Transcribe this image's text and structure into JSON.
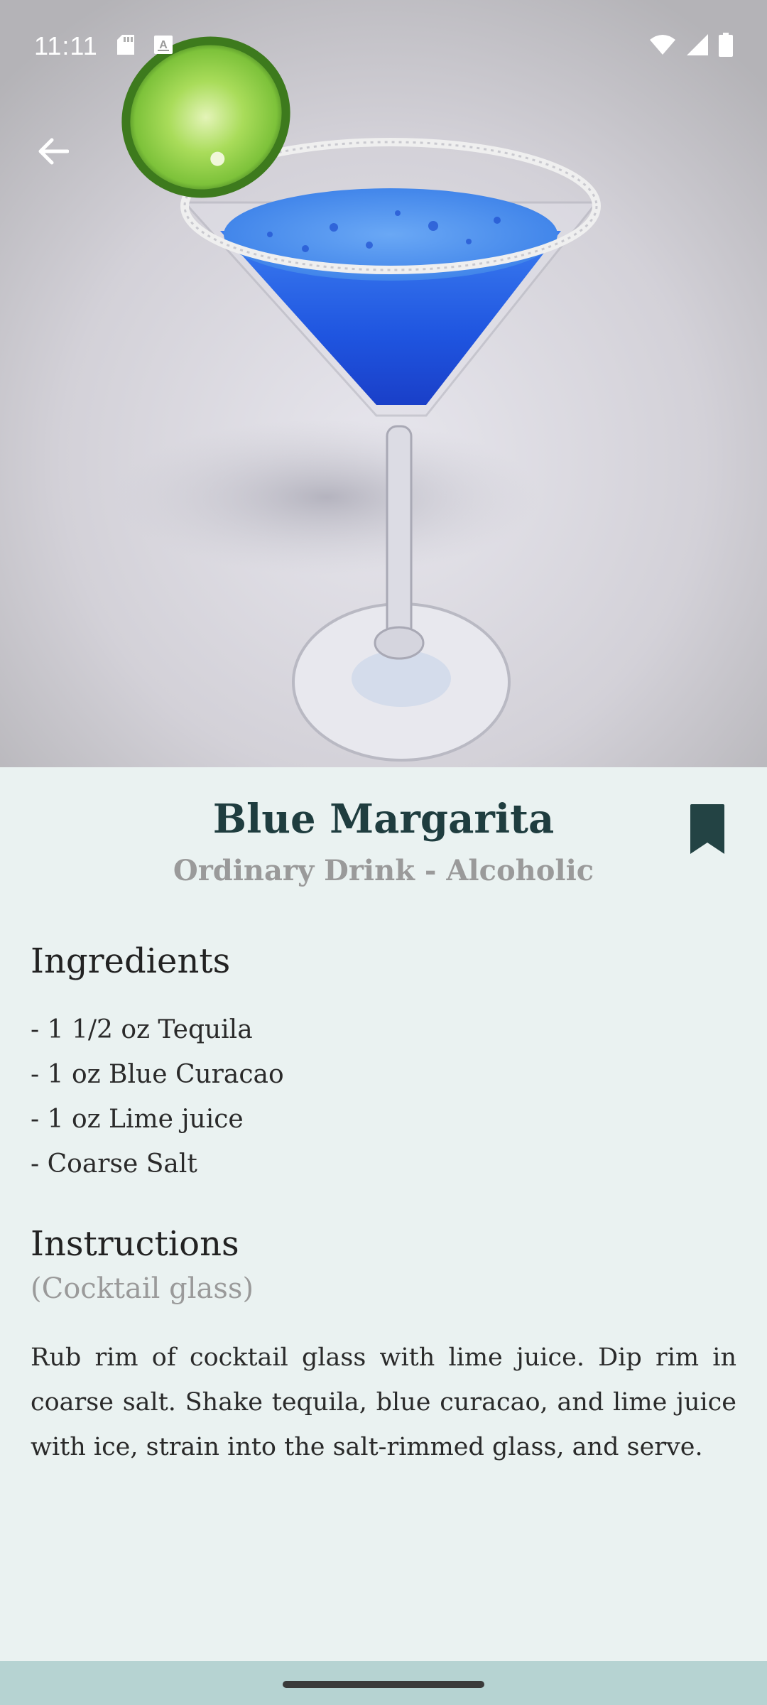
{
  "status_bar": {
    "time": "11:11",
    "icons": [
      "sd-card-icon",
      "keyboard-a-icon",
      "wifi-icon",
      "signal-icon",
      "battery-icon"
    ]
  },
  "navigation": {
    "back_icon": "arrow-left-icon"
  },
  "hero": {
    "image_name": "blue-margarita-photo",
    "colors": {
      "liquid": "#1f5fe0",
      "lime": "#8fd13f",
      "background": "#d6d5db"
    }
  },
  "drink": {
    "name": "Blue Margarita",
    "category_line": "Ordinary Drink - Alcoholic",
    "bookmark_icon": "bookmark-icon"
  },
  "ingredients": {
    "heading": "Ingredients",
    "items": [
      "- 1 1/2 oz Tequila",
      "- 1 oz Blue Curacao",
      "- 1 oz Lime juice",
      "- Coarse Salt"
    ]
  },
  "instructions": {
    "heading": "Instructions",
    "glass": "(Cocktail glass)",
    "text": "Rub rim of cocktail glass with lime juice. Dip rim in coarse salt. Shake tequila, blue curacao, and lime juice with ice, strain into the salt-rimmed glass, and serve."
  },
  "theme": {
    "background": "#eaf2f1",
    "title_color": "#1f3d3f",
    "muted_text": "#9a9a9a",
    "nav_bar": "#b6d3d2"
  }
}
